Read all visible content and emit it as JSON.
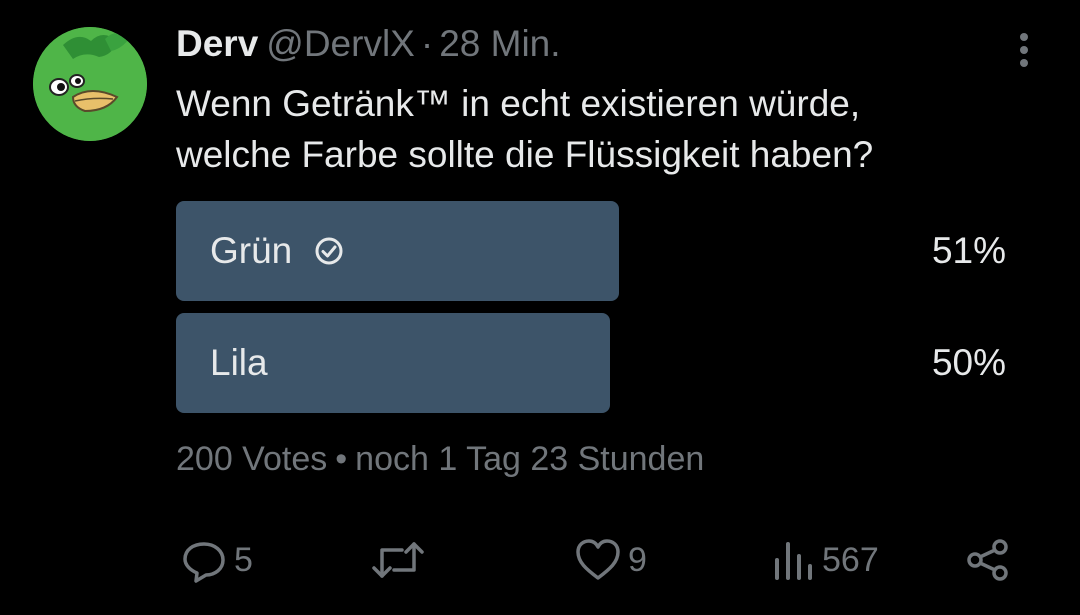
{
  "tweet": {
    "author_name": "Derv",
    "handle": "@DervlX",
    "separator": "·",
    "time": "28 Min.",
    "text_lines": [
      "Wenn Getränk™ in echt existieren würde,",
      "welche Farbe sollte die Flüssigkeit haben?"
    ]
  },
  "poll": {
    "options": [
      {
        "label": "Grün",
        "percent_label": "51%",
        "percent": 51,
        "selected": true,
        "icon": "check-circle-icon"
      },
      {
        "label": "Lila",
        "percent_label": "50%",
        "percent": 50,
        "selected": false
      }
    ],
    "votes": "200 Votes",
    "dot": "•",
    "remaining": "noch 1 Tag 23 Stunden"
  },
  "actions": {
    "reply_count": "5",
    "like_count": "9",
    "views_count": "567"
  },
  "colors": {
    "background": "#000000",
    "text": "#e7e9ea",
    "secondary": "#71767b",
    "poll_bar": "#3d5469",
    "avatar_green": "#4fb548"
  }
}
